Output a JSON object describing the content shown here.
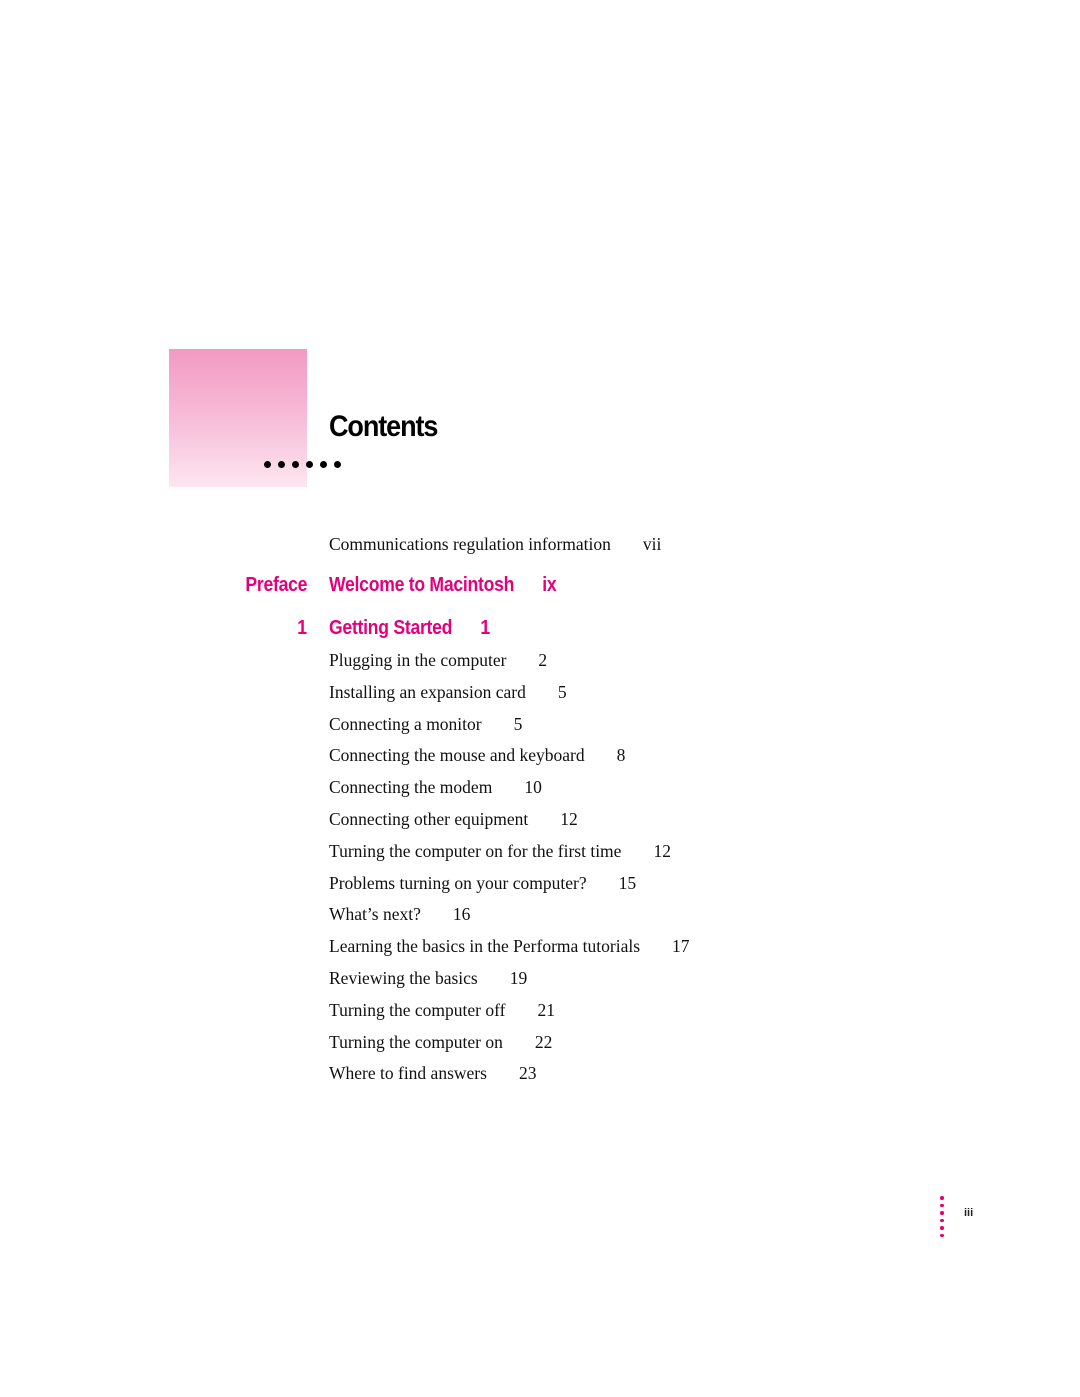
{
  "title": "Contents",
  "accent_color": "#e4007c",
  "front_matter": {
    "label": "Communications regulation information",
    "page": "vii"
  },
  "preface": {
    "label": "Preface",
    "title": "Welcome to Macintosh",
    "page": "ix"
  },
  "chapter": {
    "number": "1",
    "title": "Getting Started",
    "page": "1"
  },
  "entries": [
    {
      "label": "Plugging in the computer",
      "page": "2"
    },
    {
      "label": "Installing an expansion card",
      "page": "5"
    },
    {
      "label": "Connecting a monitor",
      "page": "5"
    },
    {
      "label": "Connecting the mouse and keyboard",
      "page": "8"
    },
    {
      "label": "Connecting the modem",
      "page": "10"
    },
    {
      "label": "Connecting other equipment",
      "page": "12"
    },
    {
      "label": "Turning the computer on for the first time",
      "page": "12"
    },
    {
      "label": "Problems turning on your computer?",
      "page": "15"
    },
    {
      "label": "What’s next?",
      "page": "16"
    },
    {
      "label": "Learning the basics in the Performa tutorials",
      "page": "17"
    },
    {
      "label": "Reviewing the basics",
      "page": "19"
    },
    {
      "label": "Turning the computer off",
      "page": "21"
    },
    {
      "label": "Turning the computer on",
      "page": "22"
    },
    {
      "label": "Where to find answers",
      "page": "23"
    }
  ],
  "folio": "iii"
}
